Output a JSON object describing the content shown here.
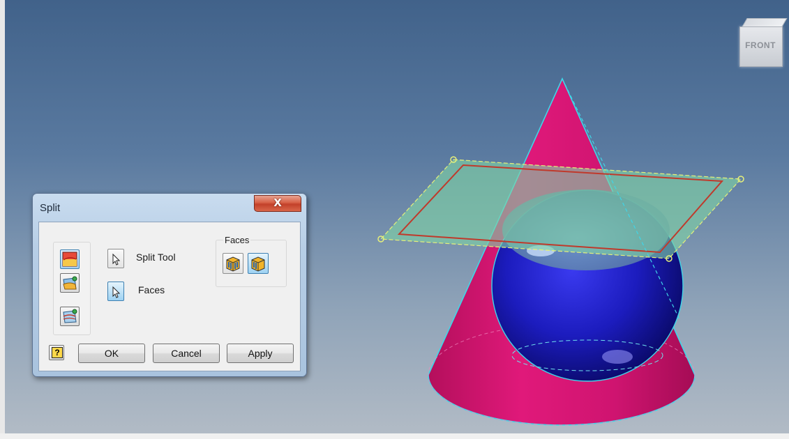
{
  "viewcube": {
    "face_label": "FRONT"
  },
  "dialog": {
    "title": "Split",
    "close_label": "X",
    "selectors": {
      "split_tool_label": "Split Tool",
      "faces_label": "Faces"
    },
    "faces_group": {
      "title": "Faces"
    },
    "help_label": "?",
    "buttons": {
      "ok": "OK",
      "cancel": "Cancel",
      "apply": "Apply"
    }
  },
  "colors": {
    "cone": "#d4166e",
    "sphere": "#1a1ab4",
    "plane": "#7fd3a4",
    "plane_boundary": "#c0392b",
    "edge_highlight": "#3fd6e8",
    "accent": "#3c7fb1"
  },
  "icons": {
    "mode_split_part": "split-part-icon",
    "mode_split_face": "split-face-icon",
    "mode_trim": "trim-solid-icon",
    "selector": "cursor-arrow-icon",
    "faces_all": "faces-all-icon",
    "faces_select": "faces-select-icon"
  }
}
